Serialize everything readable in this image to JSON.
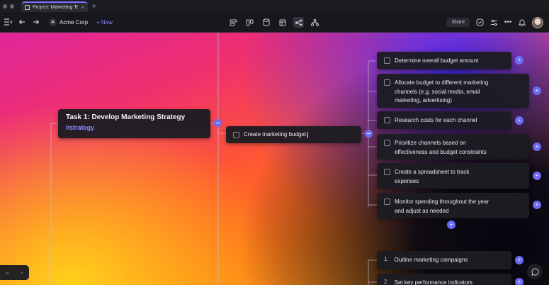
{
  "browser": {
    "tab_title": "Project: Marketing Te...",
    "tab_close": "×",
    "new_tab": "+"
  },
  "toolbar": {
    "org_name": "Acme Corp",
    "org_logo_letter": "A",
    "new_label": "+ New",
    "share_label": "Share",
    "more_label": "•••",
    "active_view": "mind-map"
  },
  "canvas": {
    "root": {
      "title": "Task 1: Develop Marketing Strategy",
      "tag": "#strategy"
    },
    "subtask": {
      "title": "Create marketing budget"
    },
    "tasks": [
      {
        "lines": [
          "Determine overall budget amount"
        ]
      },
      {
        "lines": [
          "Allocate budget to different marketing",
          "channels (e.g. social media, email",
          "marketing, advertising)"
        ]
      },
      {
        "lines": [
          "Research costs for each channel"
        ]
      },
      {
        "lines": [
          "Prioritize channels based on",
          "effectiveness and budget constraints"
        ]
      },
      {
        "lines": [
          "Create a spreadsheet to track",
          "expenses"
        ]
      },
      {
        "lines": [
          "Monitor spending throughout the year",
          "and adjust as needed"
        ]
      }
    ],
    "numbered": [
      {
        "number": "1.",
        "title": "Outline marketing campaigns"
      },
      {
        "number": "2.",
        "title": "Set key performance indicators"
      }
    ],
    "add_symbol": "+",
    "zoom": {
      "minus": "−",
      "plus": "+"
    }
  },
  "colors": {
    "accent": "#6d6af5",
    "tag": "#8c8aff",
    "card": "#1c1c22"
  }
}
